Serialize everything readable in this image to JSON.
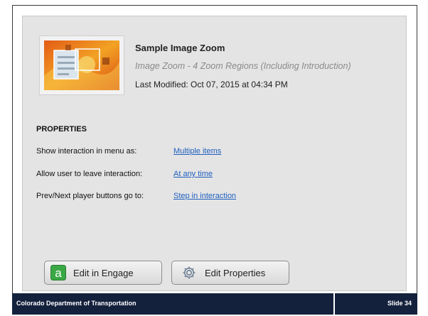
{
  "item": {
    "title": "Sample Image Zoom",
    "subtitle": "Image Zoom - 4 Zoom Regions (Including Introduction)",
    "last_modified": "Last Modified: Oct 07, 2015 at 04:34 PM",
    "thumbnail_icon": "image-zoom-thumbnail-icon"
  },
  "properties": {
    "heading": "PROPERTIES",
    "rows": [
      {
        "label": "Show interaction in menu as:",
        "value": "Multiple items"
      },
      {
        "label": "Allow user to leave interaction:",
        "value": "At any time"
      },
      {
        "label": "Prev/Next player buttons go to:",
        "value": "Step in interaction"
      }
    ]
  },
  "buttons": {
    "edit_engage": {
      "label": "Edit in Engage",
      "icon": "engage-a-icon"
    },
    "edit_properties": {
      "label": "Edit Properties",
      "icon": "gear-icon"
    }
  },
  "footer": {
    "left": "Colorado Department of Transportation",
    "right": "Slide 34"
  },
  "colors": {
    "footer_bg": "#14213d",
    "link": "#1f5fbf",
    "engage_green": "#3aa845"
  }
}
